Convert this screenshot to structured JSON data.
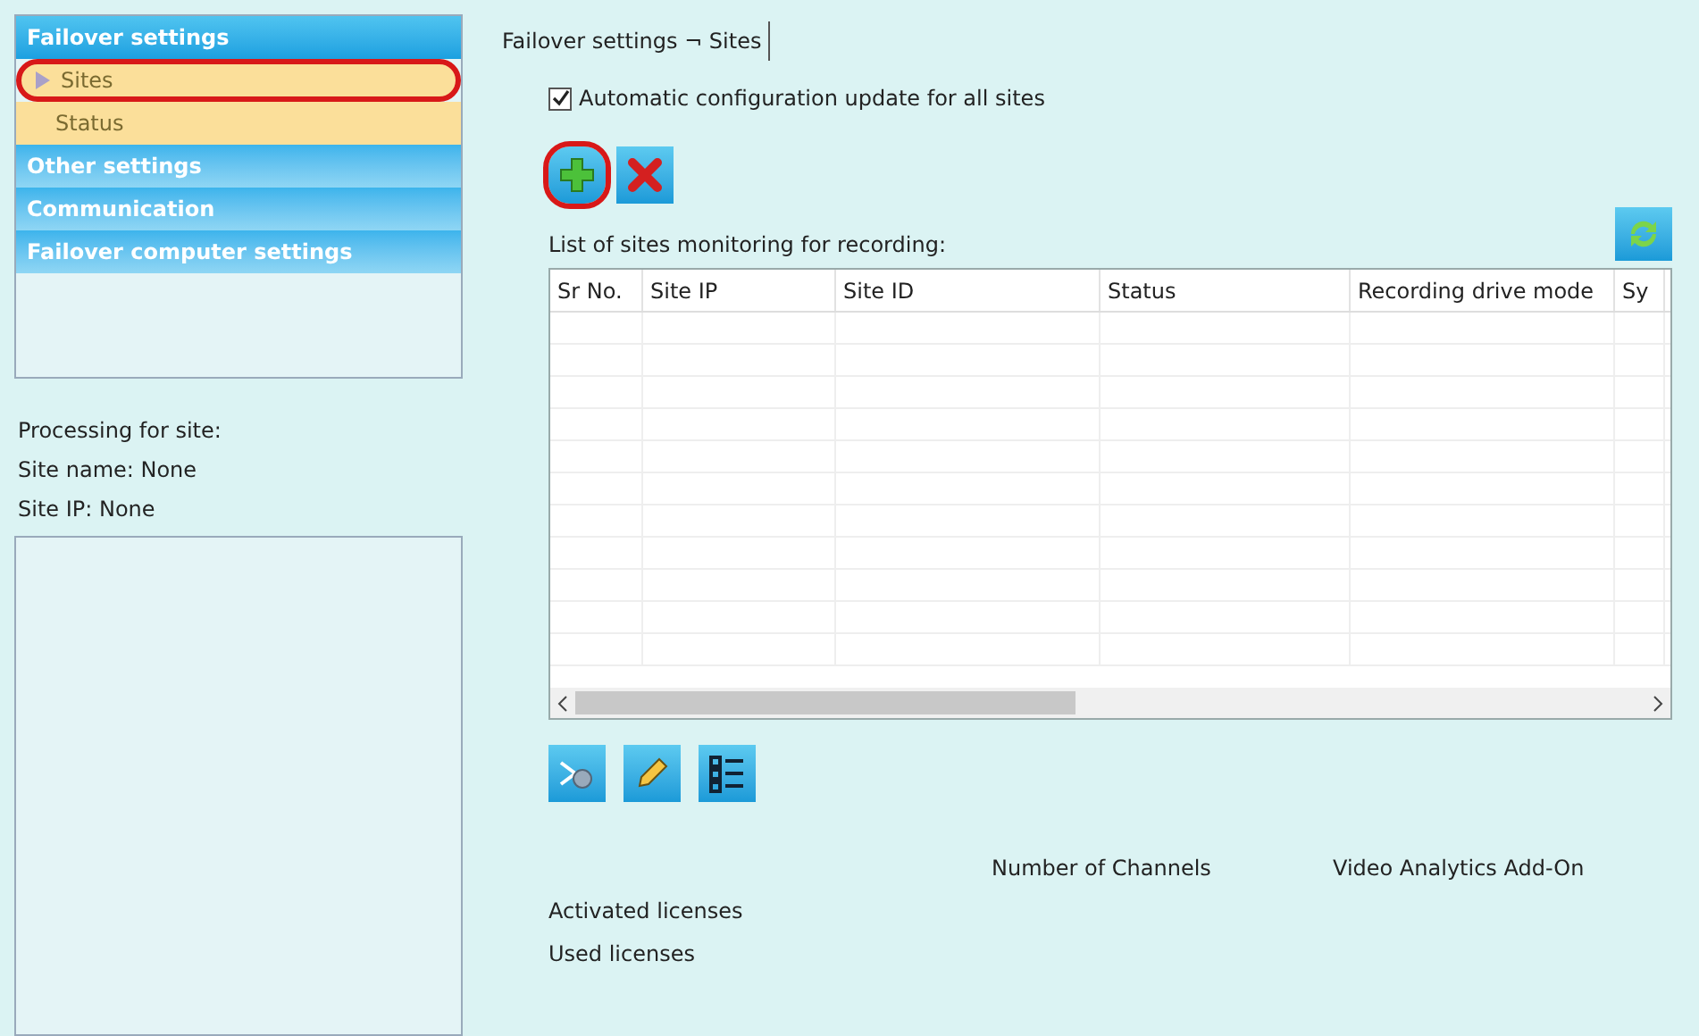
{
  "nav": {
    "sections": [
      {
        "label": "Failover settings",
        "expanded": true,
        "children": [
          {
            "label": "Sites",
            "selected": true,
            "highlighted": true
          },
          {
            "label": "Status",
            "selected": false,
            "highlighted": false
          }
        ]
      },
      {
        "label": "Other settings",
        "expanded": false
      },
      {
        "label": "Communication",
        "expanded": false
      },
      {
        "label": "Failover computer settings",
        "expanded": false
      }
    ]
  },
  "processing": {
    "lines": [
      "Processing for site:",
      "Site name: None",
      "Site IP: None"
    ]
  },
  "breadcrumb": "Failover settings ¬ Sites",
  "auto_update": {
    "label": "Automatic configuration update for all sites",
    "checked": true
  },
  "toolbar": [
    {
      "kind": "add",
      "highlighted": true
    },
    {
      "kind": "delete",
      "highlighted": false
    }
  ],
  "list_label": "List of sites monitoring for recording:",
  "table": {
    "columns": [
      "Sr No.",
      "Site IP",
      "Site ID",
      "Status",
      "Recording drive mode",
      "Sy"
    ]
  },
  "row_tools": [
    {
      "kind": "connect"
    },
    {
      "kind": "edit"
    },
    {
      "kind": "list"
    }
  ],
  "licenses": {
    "columns": [
      "Number of Channels",
      "Video Analytics Add-On"
    ],
    "rows": [
      "Activated licenses",
      "Used licenses"
    ]
  }
}
